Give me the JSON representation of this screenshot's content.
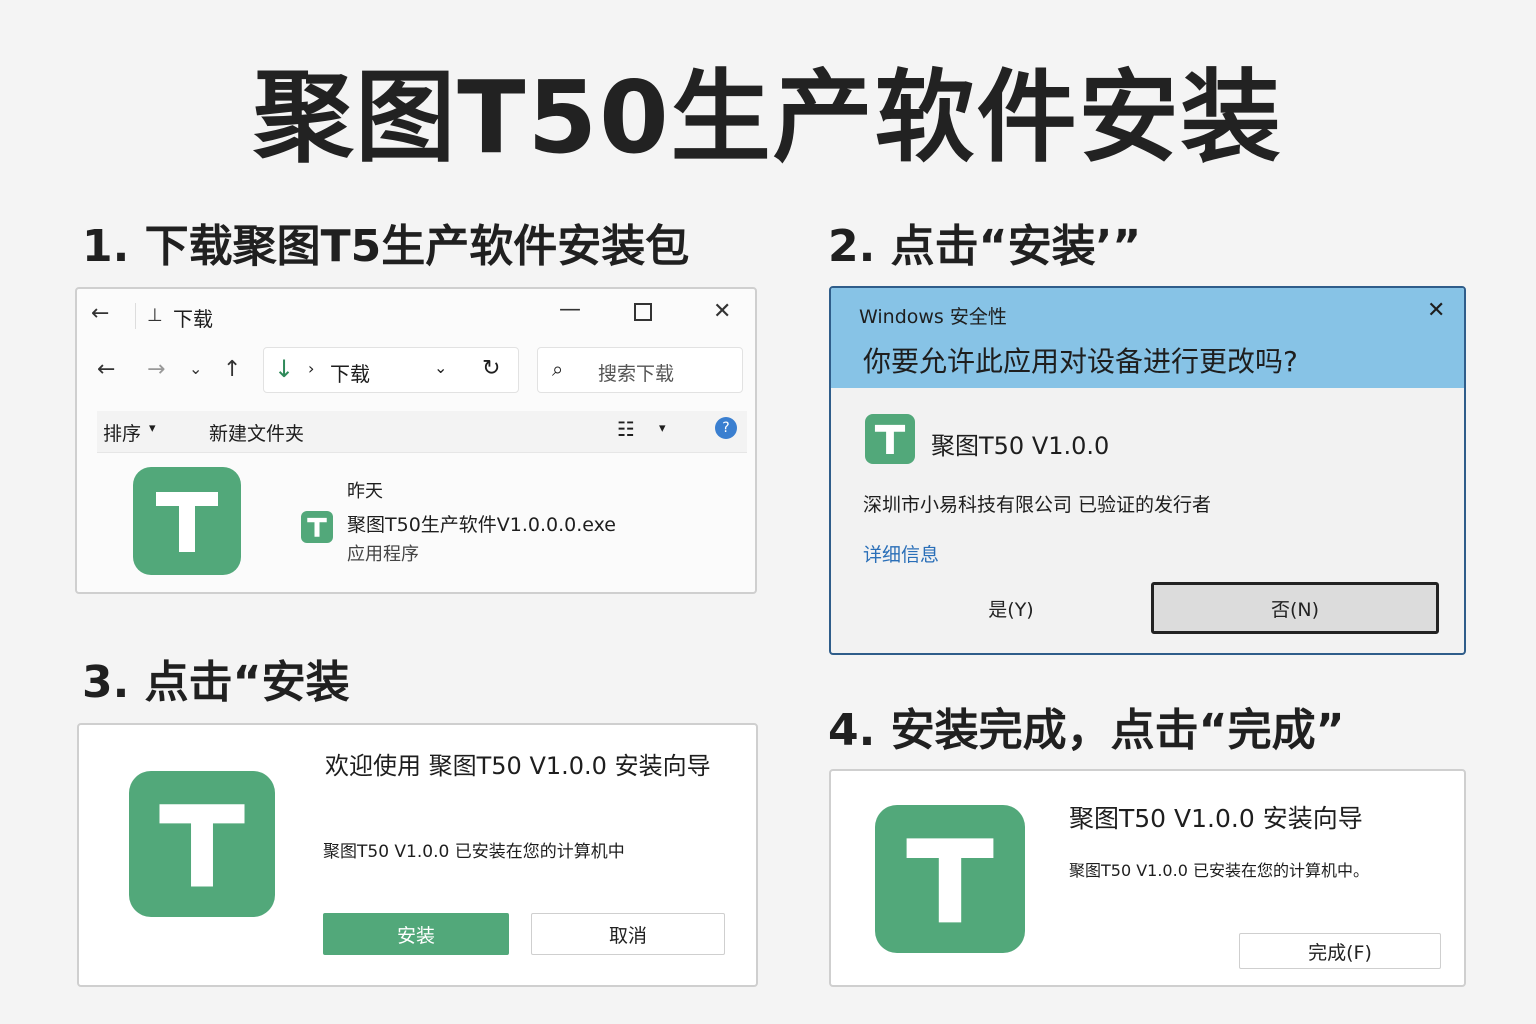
{
  "title": "聚图T50生产软件安装",
  "steps": {
    "s1": "1.  下载聚图T5生产软件安装包",
    "s2": "2.  点击“安装’”",
    "s3": "3.  点击“安装",
    "s4": "4.  安装完成，点击“完成”"
  },
  "explorer": {
    "tab_title": "下载",
    "path_label": "下载",
    "search_placeholder": "搜索下载",
    "sort_label": "排序",
    "new_folder_label": "新建文件夹",
    "file_date_label": "昨天",
    "file_name": "聚图T50生产软件V1.0.0.0.exe",
    "file_type": "应用程序"
  },
  "uac": {
    "window_title": "Windows 安全性",
    "question": "你要允许此应用对设备进行更改吗?",
    "app_name": "聚图T50 V1.0.0",
    "publisher": "深圳市小易科技有限公司 已验证的发行者",
    "more_details": "详细信息",
    "yes_button": "是(Y)",
    "no_button": "否(N)"
  },
  "installer": {
    "welcome_title": "欢迎使用 聚图T50 V1.0.0 安装向导",
    "welcome_text": "聚图T50 V1.0.0 已安装在您的计算机中",
    "install_button": "安装",
    "cancel_button": "取消"
  },
  "finish": {
    "title": "聚图T50 V1.0.0 安装向导",
    "text": "聚图T50 V1.0.0 已安装在您的计算机中。",
    "finish_button": "完成(F)"
  },
  "colors": {
    "logo_green": "#52a87a",
    "uac_blue": "#87c3e6",
    "link_blue": "#2a6fb8"
  }
}
